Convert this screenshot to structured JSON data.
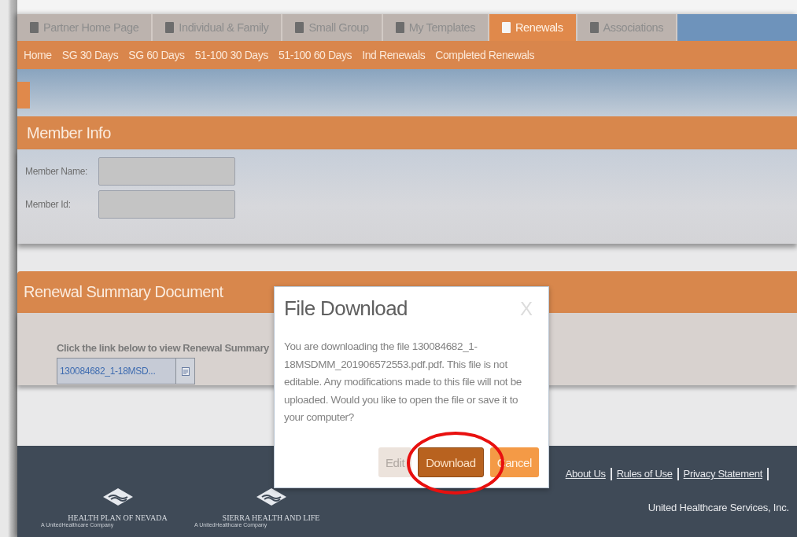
{
  "tabs": [
    {
      "label": "Partner Home Page",
      "selected": false
    },
    {
      "label": "Individual & Family",
      "selected": false
    },
    {
      "label": "Small Group",
      "selected": false
    },
    {
      "label": "My Templates",
      "selected": false
    },
    {
      "label": "Renewals",
      "selected": true
    },
    {
      "label": "Associations",
      "selected": false
    }
  ],
  "subnav": [
    "Home",
    "SG 30 Days",
    "SG 60 Days",
    "51-100 30 Days",
    "51-100 60 Days",
    "Ind Renewals",
    "Completed Renewals"
  ],
  "member_info": {
    "title": "Member Info",
    "fields": [
      {
        "label": "Member Name:"
      },
      {
        "label": "Member Id:"
      }
    ]
  },
  "renewal_summary": {
    "title": "Renewal Summary Document",
    "instruction": "Click the link below to view Renewal Summary",
    "file": "130084682_1-18MSD..."
  },
  "dialog": {
    "title": "File Download",
    "close": "X",
    "message": "You are downloading the file 130084682_1-18MSDMM_201906572553.pdf.pdf. This file is not editable. Any modifications made to this file will not be uploaded. Would you like to open the file or save it to your computer?",
    "buttons": [
      {
        "label": "Edit",
        "kind": "secondary"
      },
      {
        "label": "Download",
        "kind": "primary"
      },
      {
        "label": "Cancel",
        "kind": "warning"
      }
    ]
  },
  "footer": {
    "links": [
      "About Us",
      "Rules of Use",
      "Privacy Statement"
    ],
    "logos": [
      {
        "name": "HEALTH PLAN OF NEVADA",
        "tagline": "A UnitedHealthcare Company"
      },
      {
        "name": "SIERRA HEALTH AND LIFE",
        "tagline": "A UnitedHealthcare Company"
      }
    ],
    "copyright": "United Healthcare Services, Inc."
  }
}
